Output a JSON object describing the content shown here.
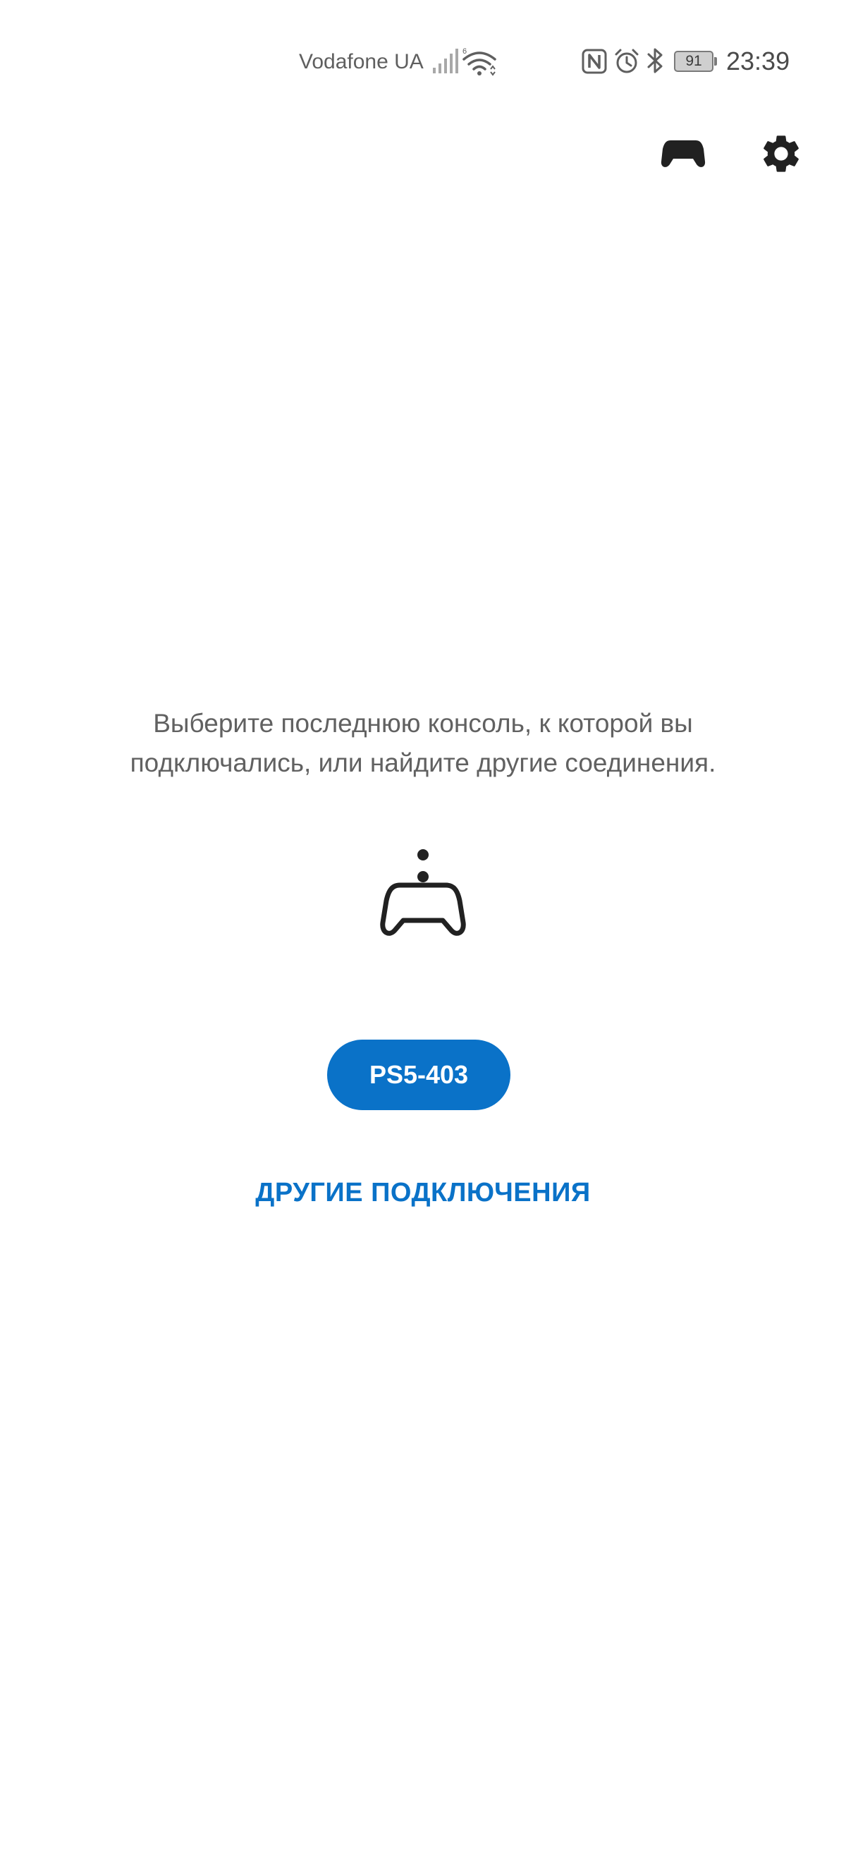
{
  "status_bar": {
    "carrier": "Vodafone UA",
    "battery_level": "91",
    "time": "23:39",
    "icons": [
      "signal-icon",
      "wifi-icon",
      "nfc-icon",
      "alarm-icon",
      "bluetooth-icon",
      "battery-icon"
    ]
  },
  "toolbar": {
    "icons": [
      "gamepad-icon",
      "gear-icon"
    ]
  },
  "main": {
    "prompt": "Выберите последнюю консоль, к которой вы подключались, или найдите другие соединения.",
    "illustration_icon": "controller-connect-icon",
    "console_button_label": "PS5-403",
    "other_connections_label": "ДРУГИЕ ПОДКЛЮЧЕНИЯ"
  },
  "colors": {
    "accent": "#0a72c8",
    "text_secondary": "#616161",
    "icon_dark": "#212121",
    "background": "#ffffff"
  }
}
